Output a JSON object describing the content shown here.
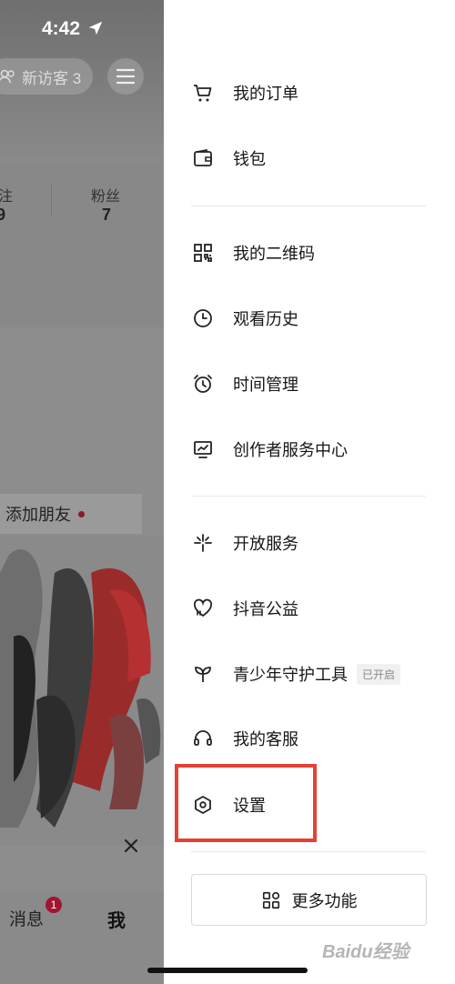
{
  "status_bar": {
    "time": "4:42"
  },
  "profile": {
    "visitor_label": "新访客 3",
    "stats": [
      {
        "label": "注",
        "value": "9"
      },
      {
        "label": "粉丝",
        "value": "7"
      }
    ],
    "add_friend_label": "添加朋友"
  },
  "tabbar": {
    "messages_label": "消息",
    "messages_badge": "1",
    "me_label": "我"
  },
  "drawer": {
    "group1": [
      {
        "label": "我的订单",
        "icon": "cart-icon"
      },
      {
        "label": "钱包",
        "icon": "wallet-icon"
      }
    ],
    "group2": [
      {
        "label": "我的二维码",
        "icon": "qr-code-icon"
      },
      {
        "label": "观看历史",
        "icon": "clock-icon"
      },
      {
        "label": "时间管理",
        "icon": "alarm-clock-icon"
      },
      {
        "label": "创作者服务中心",
        "icon": "monitor-chart-icon"
      }
    ],
    "group3": [
      {
        "label": "开放服务",
        "icon": "open-service-icon"
      },
      {
        "label": "抖音公益",
        "icon": "heart-hand-icon"
      },
      {
        "label": "青少年守护工具",
        "icon": "sprout-icon",
        "tag": "已开启"
      },
      {
        "label": "我的客服",
        "icon": "headset-icon"
      },
      {
        "label": "设置",
        "icon": "hexagon-settings-icon"
      }
    ],
    "more_button": "更多功能"
  },
  "watermark": "Baidu经验",
  "colors": {
    "highlight": "#e34234",
    "badge": "#a0162e"
  }
}
